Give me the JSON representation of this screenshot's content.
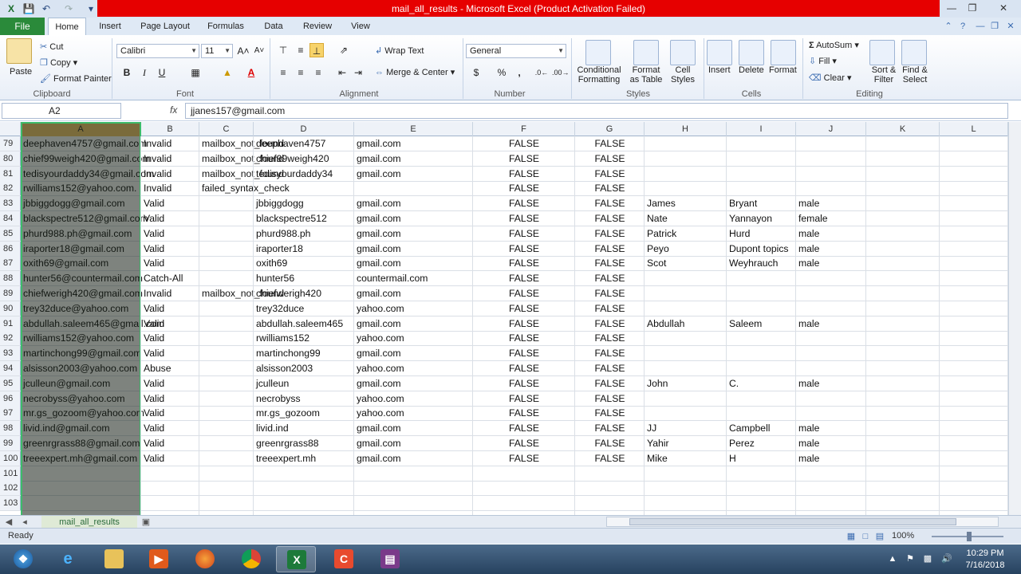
{
  "window": {
    "title": "mail_all_results - Microsoft Excel (Product Activation Failed)"
  },
  "tabs": [
    {
      "label": "File"
    },
    {
      "label": "Home"
    },
    {
      "label": "Insert"
    },
    {
      "label": "Page Layout"
    },
    {
      "label": "Formulas"
    },
    {
      "label": "Data"
    },
    {
      "label": "Review"
    },
    {
      "label": "View"
    }
  ],
  "ribbon": {
    "clipboard": {
      "paste": "Paste",
      "cut": "Cut",
      "copy": "Copy",
      "format_painter": "Format Painter",
      "label": "Clipboard"
    },
    "font": {
      "name": "Calibri",
      "size": "11",
      "bold": "B",
      "italic": "I",
      "underline": "U",
      "label": "Font"
    },
    "alignment": {
      "wrap_text": "Wrap Text",
      "merge_center": "Merge & Center",
      "label": "Alignment"
    },
    "number": {
      "format": "General",
      "currency": "$",
      "percent": "%",
      "comma": ",",
      "label": "Number"
    },
    "styles": {
      "conditional": "Conditional",
      "conditional2": "Formatting",
      "format_table": "Format",
      "format_table2": "as Table",
      "cell_styles": "Cell",
      "cell_styles2": "Styles",
      "label": "Styles"
    },
    "cells": {
      "insert": "Insert",
      "delete": "Delete",
      "format": "Format",
      "label": "Cells"
    },
    "editing": {
      "autosum": "AutoSum",
      "fill": "Fill",
      "clear": "Clear",
      "sort": "Sort &",
      "sort2": "Filter",
      "find": "Find &",
      "find2": "Select",
      "label": "Editing"
    }
  },
  "formula_bar": {
    "name_box": "A2",
    "fx": "fx",
    "value": "jjanes157@gmail.com"
  },
  "columns": [
    "A",
    "B",
    "C",
    "D",
    "E",
    "F",
    "G",
    "H",
    "I",
    "J",
    "K",
    "L"
  ],
  "rows": [
    {
      "n": "79",
      "a": "deephaven4757@gmail.com",
      "b": "Invalid",
      "c": "mailbox_not_found",
      "d": "deephaven4757",
      "e": "gmail.com",
      "f": "FALSE",
      "g": "FALSE",
      "h": "",
      "i": "",
      "j": ""
    },
    {
      "n": "80",
      "a": "chief99weigh420@gmail.com",
      "b": "Invalid",
      "c": "mailbox_not_found",
      "d": "chief99weigh420",
      "e": "gmail.com",
      "f": "FALSE",
      "g": "FALSE",
      "h": "",
      "i": "",
      "j": ""
    },
    {
      "n": "81",
      "a": "tedisyourdaddy34@gmail.com",
      "b": "Invalid",
      "c": "mailbox_not_found",
      "d": "tedisyourdaddy34",
      "e": "gmail.com",
      "f": "FALSE",
      "g": "FALSE",
      "h": "",
      "i": "",
      "j": ""
    },
    {
      "n": "82",
      "a": "rwilliams152@yahoo.com.",
      "b": "Invalid",
      "c": "failed_syntax_check",
      "d": "",
      "e": "",
      "f": "FALSE",
      "g": "FALSE",
      "h": "",
      "i": "",
      "j": ""
    },
    {
      "n": "83",
      "a": "jbbiggdogg@gmail.com",
      "b": "Valid",
      "c": "",
      "d": "jbbiggdogg",
      "e": "gmail.com",
      "f": "FALSE",
      "g": "FALSE",
      "h": "James",
      "i": "Bryant",
      "j": "male"
    },
    {
      "n": "84",
      "a": "blackspectre512@gmail.com",
      "b": "Valid",
      "c": "",
      "d": "blackspectre512",
      "e": "gmail.com",
      "f": "FALSE",
      "g": "FALSE",
      "h": "Nate",
      "i": "Yannayon",
      "j": "female"
    },
    {
      "n": "85",
      "a": "phurd988.ph@gmail.com",
      "b": "Valid",
      "c": "",
      "d": "phurd988.ph",
      "e": "gmail.com",
      "f": "FALSE",
      "g": "FALSE",
      "h": "Patrick",
      "i": "Hurd",
      "j": "male"
    },
    {
      "n": "86",
      "a": "iraporter18@gmail.com",
      "b": "Valid",
      "c": "",
      "d": "iraporter18",
      "e": "gmail.com",
      "f": "FALSE",
      "g": "FALSE",
      "h": "Peyo",
      "i": "Dupont topics",
      "j": "male"
    },
    {
      "n": "87",
      "a": "oxith69@gmail.com",
      "b": "Valid",
      "c": "",
      "d": "oxith69",
      "e": "gmail.com",
      "f": "FALSE",
      "g": "FALSE",
      "h": "Scot",
      "i": "Weyhrauch",
      "j": "male"
    },
    {
      "n": "88",
      "a": "hunter56@countermail.com",
      "b": "Catch-All",
      "c": "",
      "d": "hunter56",
      "e": "countermail.com",
      "f": "FALSE",
      "g": "FALSE",
      "h": "",
      "i": "",
      "j": ""
    },
    {
      "n": "89",
      "a": "chiefwerigh420@gmail.com",
      "b": "Invalid",
      "c": "mailbox_not_found",
      "d": "chiefwerigh420",
      "e": "gmail.com",
      "f": "FALSE",
      "g": "FALSE",
      "h": "",
      "i": "",
      "j": ""
    },
    {
      "n": "90",
      "a": "trey32duce@yahoo.com",
      "b": "Valid",
      "c": "",
      "d": "trey32duce",
      "e": "yahoo.com",
      "f": "FALSE",
      "g": "FALSE",
      "h": "",
      "i": "",
      "j": ""
    },
    {
      "n": "91",
      "a": "abdullah.saleem465@gmail.com",
      "b": "Valid",
      "c": "",
      "d": "abdullah.saleem465",
      "e": "gmail.com",
      "f": "FALSE",
      "g": "FALSE",
      "h": "Abdullah",
      "i": "Saleem",
      "j": "male"
    },
    {
      "n": "92",
      "a": "rwilliams152@yahoo.com",
      "b": "Valid",
      "c": "",
      "d": "rwilliams152",
      "e": "yahoo.com",
      "f": "FALSE",
      "g": "FALSE",
      "h": "",
      "i": "",
      "j": ""
    },
    {
      "n": "93",
      "a": "martinchong99@gmail.com",
      "b": "Valid",
      "c": "",
      "d": "martinchong99",
      "e": "gmail.com",
      "f": "FALSE",
      "g": "FALSE",
      "h": "",
      "i": "",
      "j": ""
    },
    {
      "n": "94",
      "a": "alsisson2003@yahoo.com",
      "b": "Abuse",
      "c": "",
      "d": "alsisson2003",
      "e": "yahoo.com",
      "f": "FALSE",
      "g": "FALSE",
      "h": "",
      "i": "",
      "j": ""
    },
    {
      "n": "95",
      "a": "jculleun@gmail.com",
      "b": "Valid",
      "c": "",
      "d": "jculleun",
      "e": "gmail.com",
      "f": "FALSE",
      "g": "FALSE",
      "h": "John",
      "i": "C.",
      "j": "male"
    },
    {
      "n": "96",
      "a": "necrobyss@yahoo.com",
      "b": "Valid",
      "c": "",
      "d": "necrobyss",
      "e": "yahoo.com",
      "f": "FALSE",
      "g": "FALSE",
      "h": "",
      "i": "",
      "j": ""
    },
    {
      "n": "97",
      "a": "mr.gs_gozoom@yahoo.com",
      "b": "Valid",
      "c": "",
      "d": "mr.gs_gozoom",
      "e": "yahoo.com",
      "f": "FALSE",
      "g": "FALSE",
      "h": "",
      "i": "",
      "j": ""
    },
    {
      "n": "98",
      "a": "livid.ind@gmail.com",
      "b": "Valid",
      "c": "",
      "d": "livid.ind",
      "e": "gmail.com",
      "f": "FALSE",
      "g": "FALSE",
      "h": "JJ",
      "i": "Campbell",
      "j": "male"
    },
    {
      "n": "99",
      "a": "greenrgrass88@gmail.com",
      "b": "Valid",
      "c": "",
      "d": "greenrgrass88",
      "e": "gmail.com",
      "f": "FALSE",
      "g": "FALSE",
      "h": "Yahir",
      "i": "Perez",
      "j": "male"
    },
    {
      "n": "100",
      "a": "treeexpert.mh@gmail.com",
      "b": "Valid",
      "c": "",
      "d": "treeexpert.mh",
      "e": "gmail.com",
      "f": "FALSE",
      "g": "FALSE",
      "h": "Mike",
      "i": "H",
      "j": "male"
    },
    {
      "n": "101",
      "a": "",
      "b": "",
      "c": "",
      "d": "",
      "e": "",
      "f": "",
      "g": "",
      "h": "",
      "i": "",
      "j": ""
    },
    {
      "n": "102",
      "a": "",
      "b": "",
      "c": "",
      "d": "",
      "e": "",
      "f": "",
      "g": "",
      "h": "",
      "i": "",
      "j": ""
    },
    {
      "n": "103",
      "a": "",
      "b": "",
      "c": "",
      "d": "",
      "e": "",
      "f": "",
      "g": "",
      "h": "",
      "i": "",
      "j": ""
    }
  ],
  "sheet_tab": "mail_all_results",
  "status": {
    "ready": "Ready",
    "zoom": "100%"
  },
  "clock": {
    "time": "10:29 PM",
    "date": "7/16/2018"
  },
  "colors": {
    "title_red": "#e60000",
    "file_tab": "#2a8a3a",
    "selection_border": "#3dbb6a"
  }
}
